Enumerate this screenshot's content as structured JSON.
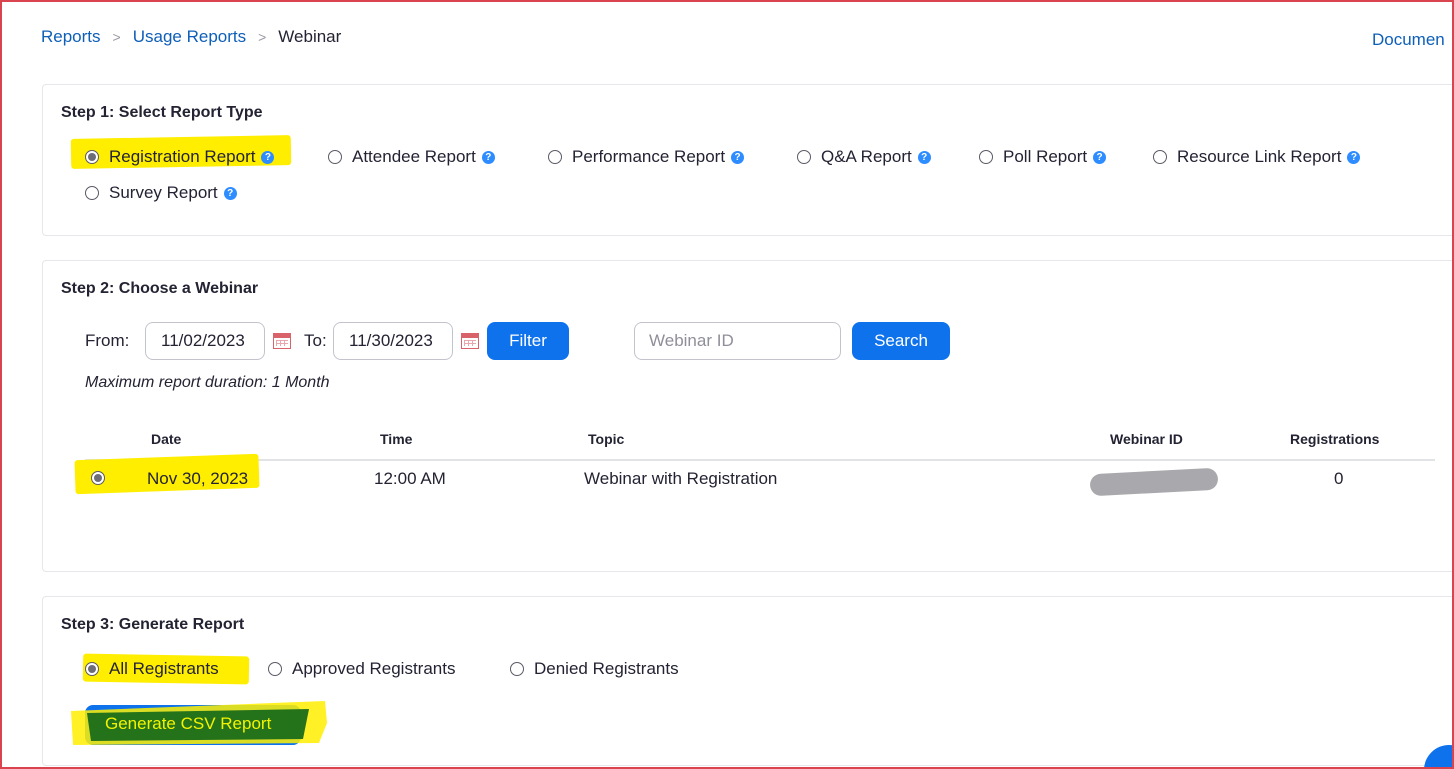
{
  "breadcrumb": {
    "item1": "Reports",
    "item2": "Usage Reports",
    "current": "Webinar",
    "separator": ">"
  },
  "doc_link": "Documen",
  "step1": {
    "title": "Step 1: Select Report Type",
    "options": [
      {
        "label": "Registration Report",
        "selected": true
      },
      {
        "label": "Attendee Report",
        "selected": false
      },
      {
        "label": "Performance Report",
        "selected": false
      },
      {
        "label": "Q&A Report",
        "selected": false
      },
      {
        "label": "Poll Report",
        "selected": false
      },
      {
        "label": "Resource Link Report",
        "selected": false
      },
      {
        "label": "Survey Report",
        "selected": false
      }
    ],
    "help_glyph": "?"
  },
  "step2": {
    "title": "Step 2: Choose a Webinar",
    "from_label": "From:",
    "from_value": "11/02/2023",
    "to_label": "To:",
    "to_value": "11/30/2023",
    "filter_label": "Filter",
    "webinar_id_placeholder": "Webinar ID",
    "search_label": "Search",
    "note": "Maximum report duration: 1 Month",
    "table": {
      "headers": [
        "Date",
        "Time",
        "Topic",
        "Webinar ID",
        "Registrations"
      ],
      "rows": [
        {
          "selected": true,
          "date": "Nov 30, 2023",
          "time": "12:00 AM",
          "topic": "Webinar with Registration",
          "webinar_id": "",
          "registrations": "0"
        }
      ]
    }
  },
  "step3": {
    "title": "Step 3: Generate Report",
    "options": [
      {
        "label": "All Registrants",
        "selected": true
      },
      {
        "label": "Approved Registrants",
        "selected": false
      },
      {
        "label": "Denied Registrants",
        "selected": false
      }
    ],
    "generate_label": "Generate CSV Report"
  },
  "colors": {
    "accent": "#0e72ed",
    "link": "#0e5fb8",
    "highlight": "#ffee00",
    "frame": "#d9444e"
  },
  "icons": {
    "calendar": "calendar-icon",
    "help": "help-circle-icon"
  }
}
